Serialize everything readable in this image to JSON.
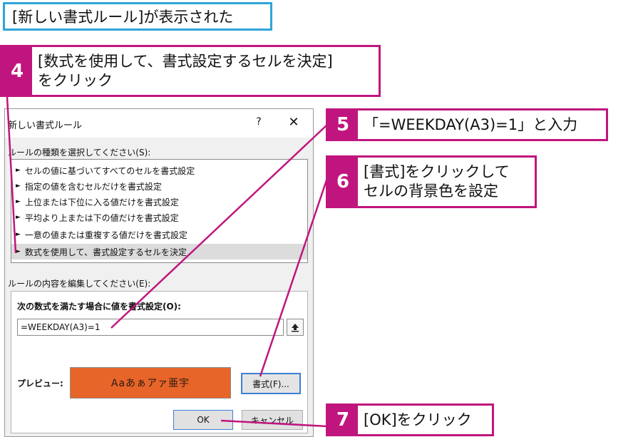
{
  "banner": {
    "text": "[新しい書式ルール]が表示された"
  },
  "steps": [
    {
      "number": "4",
      "lines": [
        "[数式を使用して、書式設定するセルを決定]",
        "をクリック"
      ]
    },
    {
      "number": "5",
      "lines": [
        "「=WEEKDAY(A3)=1」と入力"
      ]
    },
    {
      "number": "6",
      "lines": [
        "[書式]をクリックして",
        "セルの背景色を設定"
      ]
    },
    {
      "number": "7",
      "lines": [
        "[OK]をクリック"
      ]
    }
  ],
  "dialog": {
    "title": "新しい書式ルール",
    "help_icon": "?",
    "close_icon": "✕",
    "rule_type_label": "ルールの種類を選択してください(S):",
    "rule_types": [
      "セルの値に基づいてすべてのセルを書式設定",
      "指定の値を含むセルだけを書式設定",
      "上位または下位に入る値だけを書式設定",
      "平均より上または下の値だけを書式設定",
      "一意の値または重複する値だけを書式設定",
      "数式を使用して、書式設定するセルを決定"
    ],
    "selected_rule_index": 5,
    "edit_label": "ルールの内容を編集してください(E):",
    "formula_label": "次の数式を満たす場合に値を書式設定(O):",
    "formula_value": "=WEEKDAY(A3)=1",
    "preview_label": "プレビュー:",
    "preview_sample": "Aaあぁアァ亜宇",
    "preview_color": "#e8652a",
    "format_button": "書式(F)...",
    "ok_button": "OK",
    "cancel_button": "キャンセル"
  },
  "colors": {
    "accent": "#c0157e",
    "banner_border": "#2fa4d8"
  }
}
